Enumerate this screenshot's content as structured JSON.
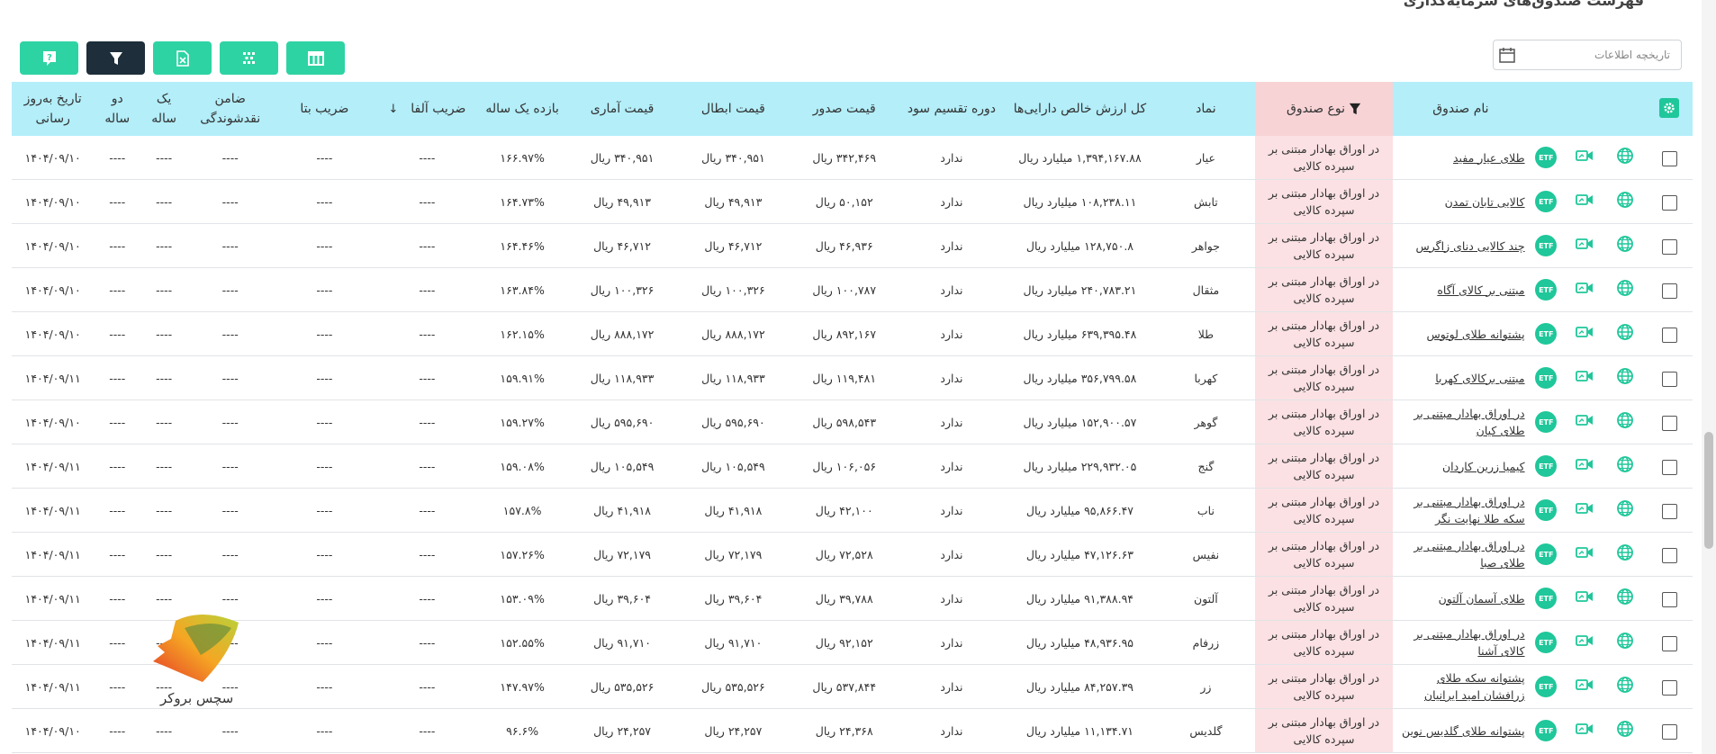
{
  "page": {
    "title": "فهرست صندوق‌های سرمایه‌گذاری"
  },
  "toolbar": {
    "date_placeholder": "تاریخچه اطلاعات",
    "buttons": [
      {
        "name": "columns-button",
        "icon": "columns-icon"
      },
      {
        "name": "qr-button",
        "icon": "qr-icon"
      },
      {
        "name": "excel-button",
        "icon": "excel-icon"
      },
      {
        "name": "filter-button",
        "icon": "filter-icon"
      },
      {
        "name": "help-button",
        "icon": "help-icon"
      }
    ]
  },
  "table": {
    "headers": {
      "name": "نام صندوق",
      "type": "نوع صندوق",
      "symbol": "نماد",
      "nav_total": "کل ارزش خالص دارایی‌ها",
      "dividend": "دوره تقسیم سود",
      "issue": "قیمت صدور",
      "cancel": "قیمت ابطال",
      "stat": "قیمت آماری",
      "yearly": "بازده یک ساله",
      "alpha": "ضریب آلفا",
      "beta": "ضریب بتا",
      "guarantor": "ضامن نقدشوندگی",
      "one_year": "یک ساله",
      "two_year": "دو ساله",
      "update": "تاریخ به‌روز رسانی"
    },
    "rows": [
      {
        "name": "طلای عیار مفید",
        "type": "در اوراق بهادار مبتنی بر سپرده کالایی",
        "symbol": "عیار",
        "nav": "۱,۳۹۴,۱۶۷.۸۸ میلیارد ریال",
        "dividend": "ندارد",
        "issue": "۳۴۲,۴۶۹ ریال",
        "cancel": "۳۴۰,۹۵۱ ریال",
        "stat": "۳۴۰,۹۵۱ ریال",
        "yearly": "۱۶۶.۹۷%",
        "alpha": "----",
        "beta": "----",
        "guarantor": "----",
        "one": "----",
        "two": "----",
        "date": "۱۴۰۴/۰۹/۱۰"
      },
      {
        "name": "کالایی تابان تمدن",
        "type": "در اوراق بهادار مبتنی بر سپرده کالایی",
        "symbol": "تابش",
        "nav": "۱۰۸,۲۳۸.۱۱ میلیارد ریال",
        "dividend": "ندارد",
        "issue": "۵۰,۱۵۲ ریال",
        "cancel": "۴۹,۹۱۳ ریال",
        "stat": "۴۹,۹۱۳ ریال",
        "yearly": "۱۶۴.۷۳%",
        "alpha": "----",
        "beta": "----",
        "guarantor": "----",
        "one": "----",
        "two": "----",
        "date": "۱۴۰۴/۰۹/۱۰"
      },
      {
        "name": "چند کالایی دنای زاگرس",
        "type": "در اوراق بهادار مبتنی بر سپرده کالایی",
        "symbol": "جواهر",
        "nav": "۱۲۸,۷۵۰.۸ میلیارد ریال",
        "dividend": "ندارد",
        "issue": "۴۶,۹۳۶ ریال",
        "cancel": "۴۶,۷۱۲ ریال",
        "stat": "۴۶,۷۱۲ ریال",
        "yearly": "۱۶۴.۴۶%",
        "alpha": "----",
        "beta": "----",
        "guarantor": "----",
        "one": "----",
        "two": "----",
        "date": "۱۴۰۴/۰۹/۱۰"
      },
      {
        "name": "مبتنی بر کالای آگاه",
        "type": "در اوراق بهادار مبتنی بر سپرده کالایی",
        "symbol": "مثقال",
        "nav": "۲۴۰,۷۸۳.۲۱ میلیارد ریال",
        "dividend": "ندارد",
        "issue": "۱۰۰,۷۸۷ ریال",
        "cancel": "۱۰۰,۳۲۶ ریال",
        "stat": "۱۰۰,۳۲۶ ریال",
        "yearly": "۱۶۳.۸۴%",
        "alpha": "----",
        "beta": "----",
        "guarantor": "----",
        "one": "----",
        "two": "----",
        "date": "۱۴۰۴/۰۹/۱۰"
      },
      {
        "name": "پشتوانه طلای لوتوس",
        "type": "در اوراق بهادار مبتنی بر سپرده کالایی",
        "symbol": "طلا",
        "nav": "۶۳۹,۳۹۵.۴۸ میلیارد ریال",
        "dividend": "ندارد",
        "issue": "۸۹۲,۱۶۷ ریال",
        "cancel": "۸۸۸,۱۷۲ ریال",
        "stat": "۸۸۸,۱۷۲ ریال",
        "yearly": "۱۶۲.۱۵%",
        "alpha": "----",
        "beta": "----",
        "guarantor": "----",
        "one": "----",
        "two": "----",
        "date": "۱۴۰۴/۰۹/۱۰"
      },
      {
        "name": "مبتنی برکالای کهربا",
        "type": "در اوراق بهادار مبتنی بر سپرده کالایی",
        "symbol": "کهربا",
        "nav": "۳۵۶,۷۹۹.۵۸ میلیارد ریال",
        "dividend": "ندارد",
        "issue": "۱۱۹,۴۸۱ ریال",
        "cancel": "۱۱۸,۹۳۳ ریال",
        "stat": "۱۱۸,۹۳۳ ریال",
        "yearly": "۱۵۹.۹۱%",
        "alpha": "----",
        "beta": "----",
        "guarantor": "----",
        "one": "----",
        "two": "----",
        "date": "۱۴۰۴/۰۹/۱۱"
      },
      {
        "name": "در اوراق بهادار مبتنی بر طلای کیان",
        "type": "در اوراق بهادار مبتنی بر سپرده کالایی",
        "symbol": "گوهر",
        "nav": "۱۵۲,۹۰۰.۵۷ میلیارد ریال",
        "dividend": "ندارد",
        "issue": "۵۹۸,۵۴۳ ریال",
        "cancel": "۵۹۵,۶۹۰ ریال",
        "stat": "۵۹۵,۶۹۰ ریال",
        "yearly": "۱۵۹.۲۷%",
        "alpha": "----",
        "beta": "----",
        "guarantor": "----",
        "one": "----",
        "two": "----",
        "date": "۱۴۰۴/۰۹/۱۰"
      },
      {
        "name": "کیمیا زرین کاردان",
        "type": "در اوراق بهادار مبتنی بر سپرده کالایی",
        "symbol": "گنج",
        "nav": "۲۲۹,۹۳۲.۰۵ میلیارد ریال",
        "dividend": "ندارد",
        "issue": "۱۰۶,۰۵۶ ریال",
        "cancel": "۱۰۵,۵۴۹ ریال",
        "stat": "۱۰۵,۵۴۹ ریال",
        "yearly": "۱۵۹.۰۸%",
        "alpha": "----",
        "beta": "----",
        "guarantor": "----",
        "one": "----",
        "two": "----",
        "date": "۱۴۰۴/۰۹/۱۱"
      },
      {
        "name": "در اوراق بهادار مبتنی بر سکه طلا نهایت نگر",
        "type": "در اوراق بهادار مبتنی بر سپرده کالایی",
        "symbol": "ناب",
        "nav": "۹۵,۸۶۶.۴۷ میلیارد ریال",
        "dividend": "ندارد",
        "issue": "۴۲,۱۰۰ ریال",
        "cancel": "۴۱,۹۱۸ ریال",
        "stat": "۴۱,۹۱۸ ریال",
        "yearly": "۱۵۷.۸%",
        "alpha": "----",
        "beta": "----",
        "guarantor": "----",
        "one": "----",
        "two": "----",
        "date": "۱۴۰۴/۰۹/۱۱"
      },
      {
        "name": "در اوراق بهادار مبتنی بر طلای صبا",
        "type": "در اوراق بهادار مبتنی بر سپرده کالایی",
        "symbol": "نفیس",
        "nav": "۴۷,۱۲۶.۶۳ میلیارد ریال",
        "dividend": "ندارد",
        "issue": "۷۲,۵۲۸ ریال",
        "cancel": "۷۲,۱۷۹ ریال",
        "stat": "۷۲,۱۷۹ ریال",
        "yearly": "۱۵۷.۲۶%",
        "alpha": "----",
        "beta": "----",
        "guarantor": "----",
        "one": "----",
        "two": "----",
        "date": "۱۴۰۴/۰۹/۱۱"
      },
      {
        "name": "طلای آسمان آلتون",
        "type": "در اوراق بهادار مبتنی بر سپرده کالایی",
        "symbol": "آلتون",
        "nav": "۹۱,۳۸۸.۹۴ میلیارد ریال",
        "dividend": "ندارد",
        "issue": "۳۹,۷۸۸ ریال",
        "cancel": "۳۹,۶۰۴ ریال",
        "stat": "۳۹,۶۰۴ ریال",
        "yearly": "۱۵۳.۰۹%",
        "alpha": "----",
        "beta": "----",
        "guarantor": "----",
        "one": "----",
        "two": "----",
        "date": "۱۴۰۴/۰۹/۱۱"
      },
      {
        "name": "در اوراق بهادار مبتنی بر کالای آشنا",
        "type": "در اوراق بهادار مبتنی بر سپرده کالایی",
        "symbol": "زرفام",
        "nav": "۴۸,۹۳۶.۹۵ میلیارد ریال",
        "dividend": "ندارد",
        "issue": "۹۲,۱۵۲ ریال",
        "cancel": "۹۱,۷۱۰ ریال",
        "stat": "۹۱,۷۱۰ ریال",
        "yearly": "۱۵۲.۵۵%",
        "alpha": "----",
        "beta": "----",
        "guarantor": "----",
        "one": "----",
        "two": "----",
        "date": "۱۴۰۴/۰۹/۱۱"
      },
      {
        "name": "پشتوانه سکه طلای زرافشان امید ایرانیان",
        "type": "در اوراق بهادار مبتنی بر سپرده کالایی",
        "symbol": "زر",
        "nav": "۸۴,۲۵۷.۳۹ میلیارد ریال",
        "dividend": "ندارد",
        "issue": "۵۳۷,۸۴۴ ریال",
        "cancel": "۵۳۵,۵۲۶ ریال",
        "stat": "۵۳۵,۵۲۶ ریال",
        "yearly": "۱۴۷.۹۷%",
        "alpha": "----",
        "beta": "----",
        "guarantor": "----",
        "one": "----",
        "two": "----",
        "date": "۱۴۰۴/۰۹/۱۱"
      },
      {
        "name": "پشتوانه طلای گلدیس نوین",
        "type": "در اوراق بهادار مبتنی بر سپرده کالایی",
        "symbol": "گلدیس",
        "nav": "۱۱,۱۳۴.۷۱ میلیارد ریال",
        "dividend": "ندارد",
        "issue": "۲۴,۳۶۸ ریال",
        "cancel": "۲۴,۲۵۷ ریال",
        "stat": "۲۴,۲۵۷ ریال",
        "yearly": "۹۶.۶%",
        "alpha": "----",
        "beta": "----",
        "guarantor": "----",
        "one": "----",
        "two": "----",
        "date": "۱۴۰۴/۰۹/۱۰"
      }
    ]
  },
  "etf_label": "ETF",
  "watermark": {
    "text": "سچس بروکر"
  },
  "colors": {
    "accent": "#2ed3a3",
    "dark": "#1e2e3b",
    "header": "#b3eef9",
    "type_col": "#fbe1e3",
    "positive": "#2a9a3f"
  }
}
